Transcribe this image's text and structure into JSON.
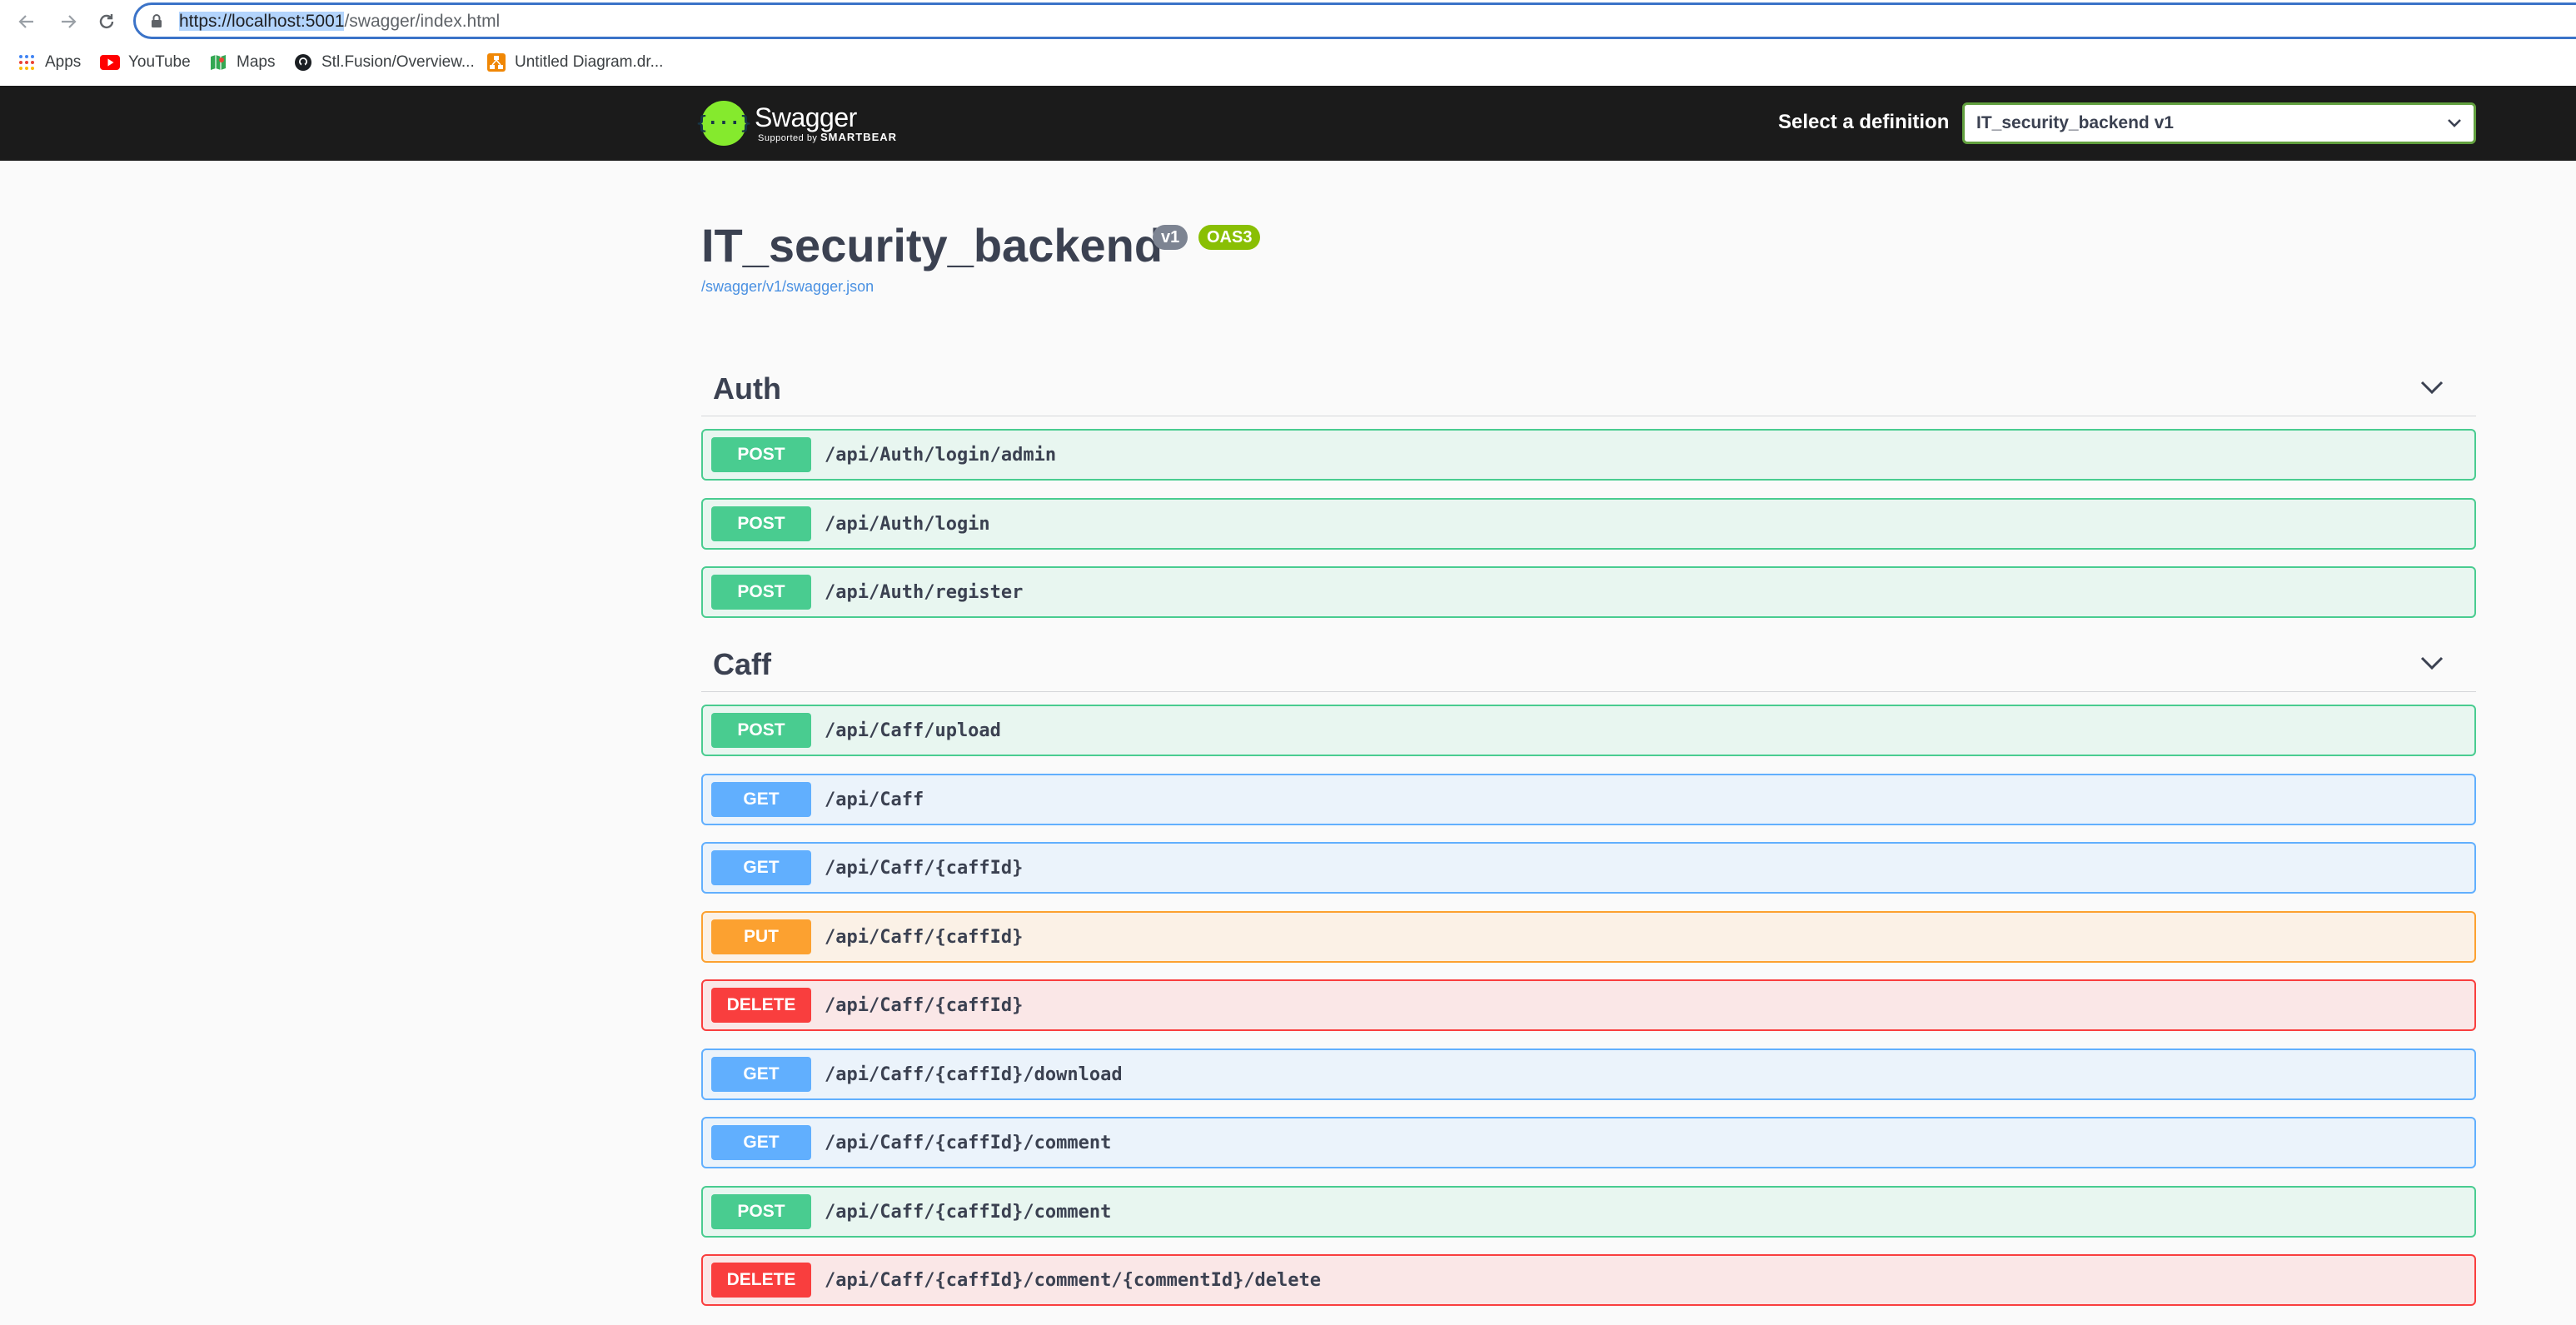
{
  "browser": {
    "url_selected": "https://localhost:5001",
    "url_rest": "/swagger/index.html",
    "bookmarks": [
      {
        "label": "Apps",
        "icon": "apps-grid-icon"
      },
      {
        "label": "YouTube",
        "icon": "youtube-icon"
      },
      {
        "label": "Maps",
        "icon": "maps-icon"
      },
      {
        "label": "Stl.Fusion/Overview...",
        "icon": "github-icon"
      },
      {
        "label": "Untitled Diagram.dr...",
        "icon": "drawio-icon"
      }
    ]
  },
  "topbar": {
    "brand": "Swagger",
    "brand_sub_prefix": "Supported by",
    "brand_sub_name": "SMARTBEAR",
    "definition_label": "Select a definition",
    "definition_value": "IT_security_backend v1"
  },
  "info": {
    "title": "IT_security_backend",
    "version_badge": "v1",
    "oas_badge": "OAS3",
    "spec_link": "/swagger/v1/swagger.json"
  },
  "tags": [
    {
      "name": "Auth",
      "operations": [
        {
          "method": "POST",
          "path": "/api/Auth/login/admin"
        },
        {
          "method": "POST",
          "path": "/api/Auth/login"
        },
        {
          "method": "POST",
          "path": "/api/Auth/register"
        }
      ]
    },
    {
      "name": "Caff",
      "operations": [
        {
          "method": "POST",
          "path": "/api/Caff/upload"
        },
        {
          "method": "GET",
          "path": "/api/Caff"
        },
        {
          "method": "GET",
          "path": "/api/Caff/{caffId}"
        },
        {
          "method": "PUT",
          "path": "/api/Caff/{caffId}"
        },
        {
          "method": "DELETE",
          "path": "/api/Caff/{caffId}"
        },
        {
          "method": "GET",
          "path": "/api/Caff/{caffId}/download"
        },
        {
          "method": "GET",
          "path": "/api/Caff/{caffId}/comment"
        },
        {
          "method": "POST",
          "path": "/api/Caff/{caffId}/comment"
        },
        {
          "method": "DELETE",
          "path": "/api/Caff/{caffId}/comment/{commentId}/delete"
        }
      ]
    }
  ],
  "colors": {
    "post": "#49cc90",
    "get": "#61affe",
    "put": "#fca130",
    "delete": "#f93e3e",
    "topbar": "#1b1b1b",
    "swagger_green": "#85ea2d"
  }
}
